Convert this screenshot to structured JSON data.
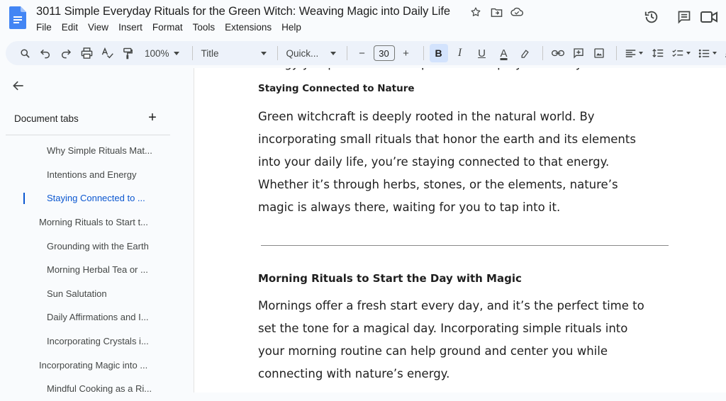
{
  "doc": {
    "title": "3011 Simple Everyday Rituals for the Green Witch: Weaving Magic into Daily Life"
  },
  "menu": [
    "File",
    "Edit",
    "View",
    "Insert",
    "Format",
    "Tools",
    "Extensions",
    "Help"
  ],
  "toolbar": {
    "zoom": "100%",
    "style": "Title",
    "font": "Quick...",
    "font_size": "30",
    "bold_label": "B",
    "italic_label": "I",
    "underline_label": "U",
    "text_color_label": "A",
    "decrease_label": "−",
    "increase_label": "+"
  },
  "sidebar": {
    "tabs_title": "Document tabs",
    "add_label": "+",
    "outline": [
      {
        "label": "Why Simple Rituals Mat...",
        "level": 2,
        "active": false
      },
      {
        "label": "Intentions and Energy",
        "level": 2,
        "active": false
      },
      {
        "label": "Staying Connected to ...",
        "level": 2,
        "active": true
      },
      {
        "label": "Morning Rituals to Start t...",
        "level": 1,
        "active": false
      },
      {
        "label": "Grounding with the Earth",
        "level": 2,
        "active": false
      },
      {
        "label": "Morning Herbal Tea or ...",
        "level": 2,
        "active": false
      },
      {
        "label": "Sun Salutation",
        "level": 2,
        "active": false
      },
      {
        "label": "Daily Affirmations and I...",
        "level": 2,
        "active": false
      },
      {
        "label": "Incorporating Crystals i...",
        "level": 2,
        "active": false
      },
      {
        "label": "Incorporating Magic into ...",
        "level": 1,
        "active": false
      },
      {
        "label": "Mindful Cooking as a Ri...",
        "level": 2,
        "active": false
      }
    ]
  },
  "content": {
    "cut_line": "energy you put out has the power to shape your reality.",
    "heading1": "Staying Connected to Nature",
    "para1": [
      "Green witchcraft is deeply rooted in the natural world. By",
      "incorporating small rituals that honor the earth and its elements",
      "into your daily life, you’re staying connected to that energy.",
      "Whether it’s through herbs, stones, or the elements, nature’s",
      "magic is always there, waiting for you to tap into it."
    ],
    "heading2": "Morning Rituals to Start the Day with Magic",
    "para2": [
      "Mornings offer a fresh start every day, and it’s the perfect time to",
      "set the tone for a magical day. Incorporating simple rituals into",
      "your morning routine can help ground and center you while",
      "connecting with nature’s energy."
    ]
  },
  "colors": {
    "accent": "#0b57d0",
    "docs_blue": "#4285f4",
    "toolbar_bg": "#edf2fa",
    "active_button_bg": "#d3e3fd"
  }
}
